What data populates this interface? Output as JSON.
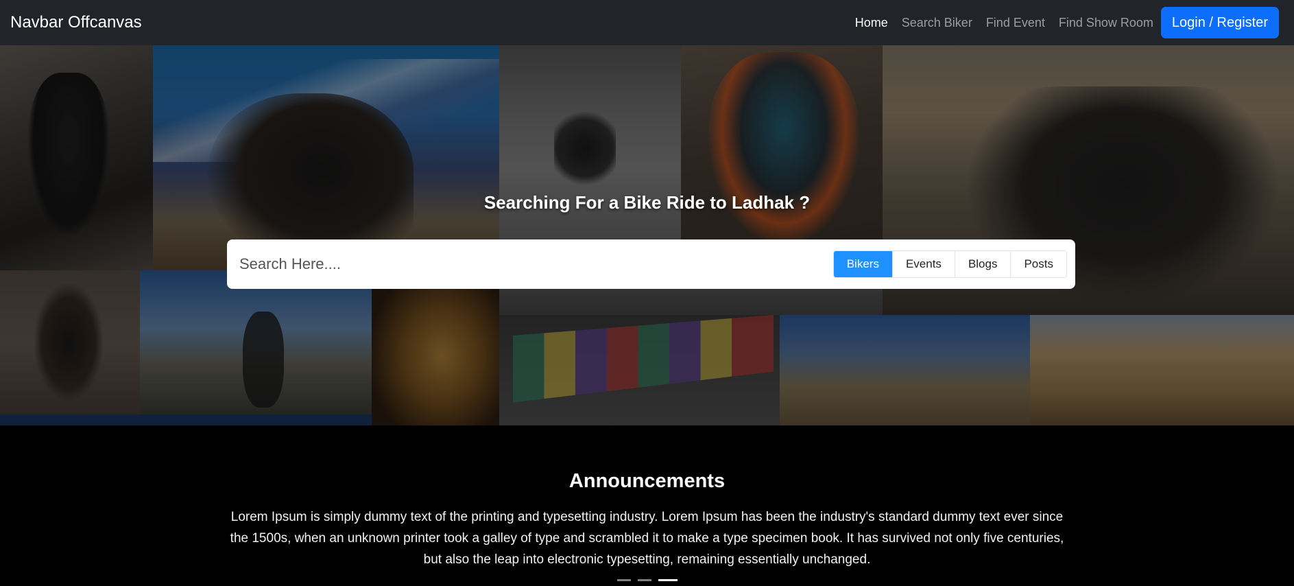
{
  "navbar": {
    "brand": "Navbar Offcanvas",
    "links": [
      {
        "label": "Home",
        "active": true
      },
      {
        "label": "Search Biker",
        "active": false
      },
      {
        "label": "Find Event",
        "active": false
      },
      {
        "label": "Find Show Room",
        "active": false
      }
    ],
    "login_label": "Login / Register"
  },
  "hero": {
    "title": "Searching For a Bike Ride to Ladhak ?",
    "search_placeholder": "Search Here....",
    "filters": [
      {
        "label": "Bikers",
        "active": true
      },
      {
        "label": "Events",
        "active": false
      },
      {
        "label": "Blogs",
        "active": false
      },
      {
        "label": "Posts",
        "active": false
      }
    ]
  },
  "announcements": {
    "title": "Announcements",
    "text": "Lorem Ipsum is simply dummy text of the printing and typesetting industry. Lorem Ipsum has been the industry's standard dummy text ever since the 1500s, when an unknown printer took a galley of type and scrambled it to make a type specimen book. It has survived not only five centuries, but also the leap into electronic typesetting, remaining essentially unchanged.",
    "slides": 3,
    "active_slide": 3
  },
  "colors": {
    "navbar_bg": "#212529",
    "primary": "#0d6efd",
    "filter_active": "#1e90ff"
  }
}
